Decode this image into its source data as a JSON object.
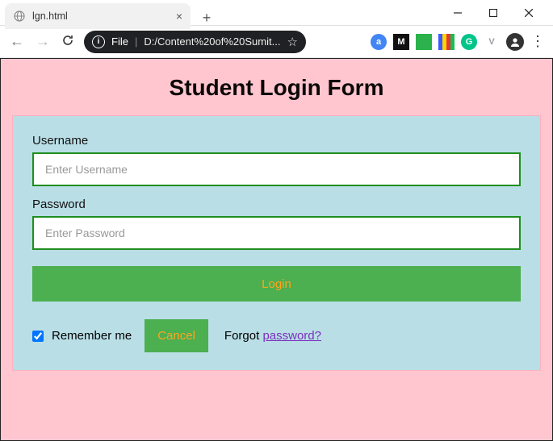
{
  "window": {
    "tab_title": "lgn.html"
  },
  "toolbar": {
    "file_scheme_label": "File",
    "url_text": "D:/Content%20of%20Sumit..."
  },
  "extensions": [
    {
      "bg": "#4285f4",
      "label": "a",
      "text_color": "#fff"
    },
    {
      "bg": "#111111",
      "label": "M",
      "text_color": "#fff"
    },
    {
      "bg": "#2bb24c",
      "label": "",
      "text_color": "#fff"
    },
    {
      "bg": "linear",
      "label": "",
      "text_color": "#fff"
    },
    {
      "bg": "#00c48a",
      "label": "G",
      "text_color": "#fff"
    },
    {
      "bg": "transparent",
      "label": "V",
      "text_color": "#9aa0a6"
    }
  ],
  "page": {
    "title": "Student Login Form",
    "form": {
      "username_label": "Username",
      "username_placeholder": "Enter Username",
      "password_label": "Password",
      "password_placeholder": "Enter Password",
      "login_button": "Login",
      "remember_checked": true,
      "remember_label": "Remember me",
      "cancel_button": "Cancel",
      "forgot_prefix": "Forgot ",
      "forgot_link": "password?"
    }
  }
}
